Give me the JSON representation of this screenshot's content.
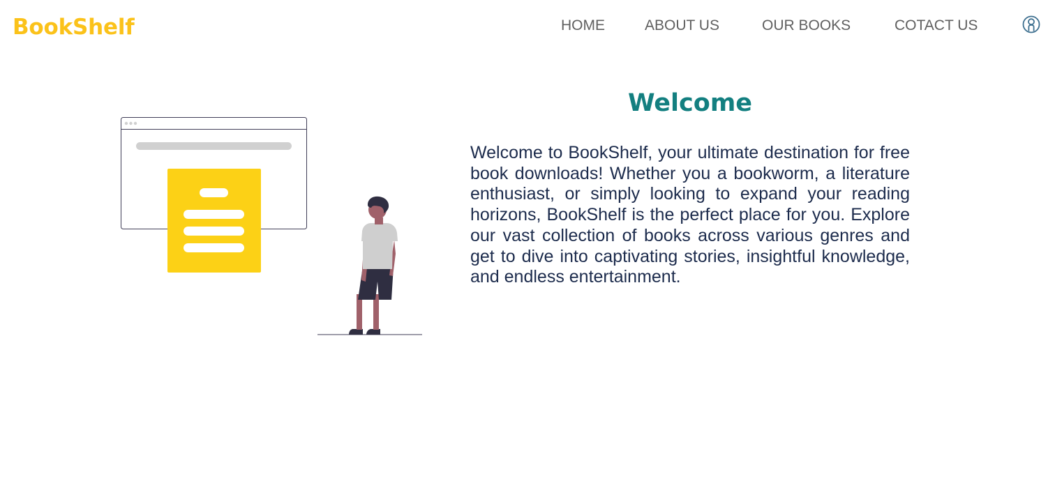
{
  "header": {
    "logo": "BookShelf",
    "nav": {
      "home": "HOME",
      "about": "ABOUT US",
      "books": "OUR BOOKS",
      "contact": "COTACT US"
    },
    "user_icon": "user-circle-icon"
  },
  "main": {
    "title": "Welcome",
    "body": "Welcome to BookShelf, your ultimate destination for free book downloads! Whether you a bookworm, a literature enthusiast, or simply looking to expand your reading horizons, BookShelf is the perfect place for you. Explore our vast collection of books across various genres and get to dive into captivating stories, insightful knowledge, and endless entertainment."
  },
  "colors": {
    "brand": "#fbc21a",
    "title": "#137f80",
    "text": "#1c2b4c",
    "nav": "#5f5f5f",
    "accent_yellow": "#fcd116"
  }
}
